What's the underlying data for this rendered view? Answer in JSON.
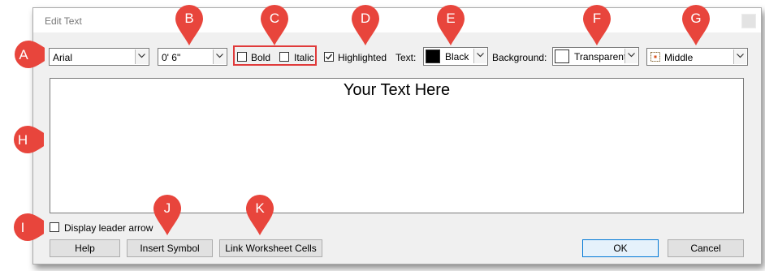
{
  "dialog": {
    "title": "Edit Text"
  },
  "toolbar": {
    "font": "Arial",
    "size": "0' 6\"",
    "bold_label": "Bold",
    "italic_label": "Italic",
    "highlighted_label": "Highlighted",
    "highlighted_checked": true,
    "text_label": "Text:",
    "text_color": "Black",
    "text_color_hex": "#000000",
    "background_label": "Background:",
    "background_color": "Transparent",
    "alignment": "Middle"
  },
  "editor": {
    "content": "Your Text Here"
  },
  "options": {
    "leader_arrow_label": "Display leader arrow"
  },
  "buttons": {
    "help": "Help",
    "insert_symbol": "Insert Symbol",
    "link_cells": "Link Worksheet Cells",
    "ok": "OK",
    "cancel": "Cancel"
  },
  "callouts": {
    "a": "A",
    "b": "B",
    "c": "C",
    "d": "D",
    "e": "E",
    "f": "F",
    "g": "G",
    "h": "H",
    "i": "I",
    "j": "J",
    "k": "K"
  },
  "colors": {
    "callout": "#e8453c",
    "highlight_box": "#e03a3a",
    "ok_border": "#0078d7"
  },
  "icons": [
    "chevron-down-icon",
    "check-icon",
    "middle-align-icon",
    "close-icon",
    "map-pin-icon"
  ]
}
